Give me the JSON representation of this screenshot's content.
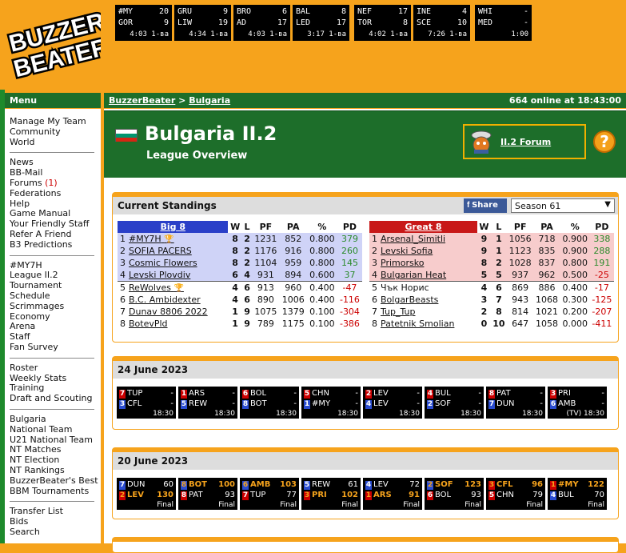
{
  "scoreboard": [
    {
      "a": "#MY",
      "as": "20",
      "b": "GOR",
      "bs": "9",
      "t": "4:03 1-ва"
    },
    {
      "a": "GRU",
      "as": "9",
      "b": "LIW",
      "bs": "19",
      "t": "4:34 1-ва"
    },
    {
      "a": "BRO",
      "as": "6",
      "b": "AD",
      "bs": "17",
      "t": "4:03 1-ва"
    },
    {
      "a": "BAL",
      "as": "8",
      "b": "LED",
      "bs": "17",
      "t": "3:17 1-ва"
    },
    {
      "a": "NEF",
      "as": "17",
      "b": "TOR",
      "bs": "8",
      "t": "4:02 1-ва"
    },
    {
      "a": "INE",
      "as": "4",
      "b": "SCE",
      "bs": "10",
      "t": "7:26 1-ва"
    },
    {
      "a": "WHI",
      "as": "-",
      "b": "MED",
      "bs": "-",
      "t": "1:00"
    }
  ],
  "nav": {
    "title": "Menu",
    "groups": [
      [
        "Manage My Team",
        "Community",
        "World"
      ],
      [
        "News",
        "BB-Mail",
        "Forums",
        "Federations",
        "Help",
        "Game Manual",
        "Your Friendly Staff",
        "Refer A Friend",
        "B3 Predictions"
      ],
      [
        "#MY7H",
        "League II.2",
        "Tournament",
        "Schedule",
        "Scrimmages",
        "Economy",
        "Arena",
        "Staff",
        "Fan Survey"
      ],
      [
        "Roster",
        "Weekly Stats",
        "Training",
        "Draft and Scouting"
      ],
      [
        "Bulgaria",
        "National Team",
        "U21 National Team",
        "NT Matches",
        "NT Election",
        "NT Rankings",
        "BuzzerBeater's Best",
        "BBM Tournaments"
      ],
      [
        "Transfer List",
        "Bids",
        "Search"
      ]
    ],
    "forums_count": "(1)"
  },
  "breadcrumb": {
    "root": "BuzzerBeater",
    "sep": " > ",
    "current": "Bulgaria"
  },
  "online": "664 online at 18:43:00",
  "league": {
    "title": "Bulgaria II.2",
    "subtitle": "League Overview",
    "forum": "II.2 Forum",
    "help": "?"
  },
  "standings": {
    "title": "Current Standings",
    "share": "Share",
    "season": "Season 61",
    "cols": [
      "W",
      "L",
      "PF",
      "PA",
      "%",
      "PD"
    ],
    "conf": [
      {
        "name": "Big 8",
        "rows": [
          [
            "1",
            "#MY7H",
            "8",
            "2",
            "1231",
            "852",
            "0.800",
            "379",
            true
          ],
          [
            "2",
            "SOFIA PACERS",
            "8",
            "2",
            "1176",
            "916",
            "0.800",
            "260",
            false
          ],
          [
            "3",
            "Cosmic Flowers",
            "8",
            "2",
            "1104",
            "959",
            "0.800",
            "145",
            false
          ],
          [
            "4",
            "Levski Plovdiv",
            "6",
            "4",
            "931",
            "894",
            "0.600",
            "37",
            false
          ],
          [
            "5",
            "ReWolves",
            "4",
            "6",
            "913",
            "960",
            "0.400",
            "-47",
            true
          ],
          [
            "6",
            "B.C. Ambidexter",
            "4",
            "6",
            "890",
            "1006",
            "0.400",
            "-116",
            false
          ],
          [
            "7",
            "Dunav 8806 2022",
            "1",
            "9",
            "1075",
            "1379",
            "0.100",
            "-304",
            false
          ],
          [
            "8",
            "BotevPld",
            "1",
            "9",
            "789",
            "1175",
            "0.100",
            "-386",
            false
          ]
        ]
      },
      {
        "name": "Great 8",
        "rows": [
          [
            "1",
            "Arsenal_Simitli",
            "9",
            "1",
            "1056",
            "718",
            "0.900",
            "338",
            false
          ],
          [
            "2",
            "Levski Sofia",
            "9",
            "1",
            "1123",
            "835",
            "0.900",
            "288",
            false
          ],
          [
            "3",
            "Primorsko",
            "8",
            "2",
            "1028",
            "837",
            "0.800",
            "191",
            false
          ],
          [
            "4",
            "Bulgarian Heat",
            "5",
            "5",
            "937",
            "962",
            "0.500",
            "-25",
            false
          ],
          [
            "5",
            "Чък Норис",
            "4",
            "6",
            "869",
            "886",
            "0.400",
            "-17",
            false
          ],
          [
            "6",
            "BolgarBeasts",
            "3",
            "7",
            "943",
            "1068",
            "0.300",
            "-125",
            false
          ],
          [
            "7",
            "Tup_Tup",
            "2",
            "8",
            "814",
            "1021",
            "0.200",
            "-207",
            false
          ],
          [
            "8",
            "Patetnik Smolian",
            "0",
            "10",
            "647",
            "1058",
            "0.000",
            "-411",
            false
          ]
        ]
      }
    ]
  },
  "days": [
    {
      "date": "24 June 2023",
      "games": [
        {
          "h": "TUP",
          "hs": "-",
          "hn": "7",
          "hc": "red",
          "a": "CFL",
          "as": "-",
          "an": "3",
          "ac": "blue",
          "t": "18:30",
          "w": ""
        },
        {
          "h": "ARS",
          "hs": "-",
          "hn": "1",
          "hc": "red",
          "a": "REW",
          "as": "-",
          "an": "5",
          "ac": "blue",
          "t": "18:30",
          "w": ""
        },
        {
          "h": "BOL",
          "hs": "-",
          "hn": "6",
          "hc": "red",
          "a": "BOT",
          "as": "-",
          "an": "8",
          "ac": "blue",
          "t": "18:30",
          "w": ""
        },
        {
          "h": "CHN",
          "hs": "-",
          "hn": "5",
          "hc": "red",
          "a": "#MY",
          "as": "-",
          "an": "1",
          "ac": "blue",
          "t": "18:30",
          "w": ""
        },
        {
          "h": "LEV",
          "hs": "-",
          "hn": "2",
          "hc": "red",
          "a": "LEV",
          "as": "-",
          "an": "4",
          "ac": "blue",
          "t": "18:30",
          "w": ""
        },
        {
          "h": "BUL",
          "hs": "-",
          "hn": "4",
          "hc": "red",
          "a": "SOF",
          "as": "-",
          "an": "2",
          "ac": "blue",
          "t": "18:30",
          "w": ""
        },
        {
          "h": "PAT",
          "hs": "-",
          "hn": "8",
          "hc": "red",
          "a": "DUN",
          "as": "-",
          "an": "7",
          "ac": "blue",
          "t": "18:30",
          "w": ""
        },
        {
          "h": "PRI",
          "hs": "-",
          "hn": "3",
          "hc": "red",
          "a": "AMB",
          "as": "-",
          "an": "6",
          "ac": "blue",
          "t": "(TV) 18:30",
          "w": ""
        }
      ]
    },
    {
      "date": "20 June 2023",
      "games": [
        {
          "a": "DUN",
          "as": "60",
          "an": "7",
          "ac": "blue",
          "h": "LEV",
          "hs": "130",
          "hn": "2",
          "hc": "red",
          "t": "Final",
          "w": "h"
        },
        {
          "a": "BOT",
          "as": "100",
          "an": "8",
          "ac": "blue",
          "h": "PAT",
          "hs": "93",
          "hn": "8",
          "hc": "red",
          "t": "Final",
          "w": "a"
        },
        {
          "a": "AMB",
          "as": "103",
          "an": "6",
          "ac": "blue",
          "h": "TUP",
          "hs": "77",
          "hn": "7",
          "hc": "red",
          "t": "Final",
          "w": "a"
        },
        {
          "a": "REW",
          "as": "61",
          "an": "5",
          "ac": "blue",
          "h": "PRI",
          "hs": "102",
          "hn": "3",
          "hc": "red",
          "t": "Final",
          "w": "h"
        },
        {
          "a": "LEV",
          "as": "72",
          "an": "4",
          "ac": "blue",
          "h": "ARS",
          "hs": "91",
          "hn": "1",
          "hc": "red",
          "t": "Final",
          "w": "h"
        },
        {
          "a": "SOF",
          "as": "123",
          "an": "2",
          "ac": "blue",
          "h": "BOL",
          "hs": "93",
          "hn": "6",
          "hc": "red",
          "t": "Final",
          "w": "a"
        },
        {
          "a": "CFL",
          "as": "96",
          "an": "3",
          "ac": "red",
          "h": "CHN",
          "hs": "79",
          "hn": "5",
          "hc": "red",
          "t": "Final",
          "w": "a"
        },
        {
          "a": "#MY",
          "as": "122",
          "an": "1",
          "ac": "red",
          "h": "BUL",
          "hs": "70",
          "hn": "4",
          "hc": "blue",
          "t": "Final",
          "w": "a"
        }
      ]
    }
  ],
  "colors": {
    "orange": "#f6a31c",
    "green": "#1d6e2a",
    "big8": "#cfd3f7",
    "great8": "#f7cccc"
  }
}
